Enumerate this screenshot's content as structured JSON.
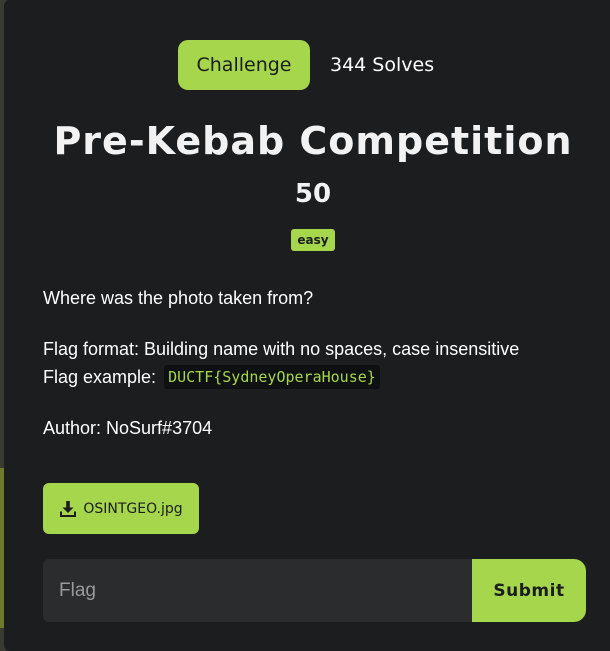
{
  "header": {
    "tab_label": "Challenge",
    "solves_label": "344 Solves"
  },
  "challenge": {
    "title": "Pre-Kebab Competition",
    "points": "50",
    "difficulty": "easy",
    "question": "Where was the photo taken from?",
    "flag_format": "Flag format: Building name with no spaces, case insensitive",
    "flag_example_label": "Flag example:",
    "flag_example_code": "DUCTF{SydneyOperaHouse}",
    "author": "Author: NoSurf#3704"
  },
  "attachment": {
    "file_name": "OSINTGEO.jpg",
    "icon": "download-icon"
  },
  "form": {
    "placeholder": "Flag",
    "value": "",
    "submit_label": "Submit"
  },
  "colors": {
    "accent": "#a5d64b",
    "modal_background": "#1c1d1f",
    "input_background": "#2b2c2e"
  }
}
